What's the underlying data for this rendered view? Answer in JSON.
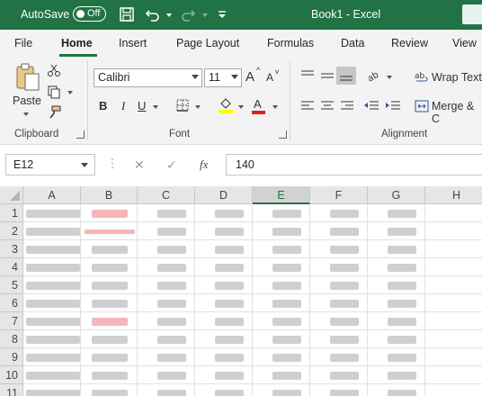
{
  "titlebar": {
    "autosave_label": "AutoSave",
    "toggle_state": "Off",
    "title": "Book1 - Excel"
  },
  "tabs": [
    {
      "label": "File",
      "active": false
    },
    {
      "label": "Home",
      "active": true
    },
    {
      "label": "Insert",
      "active": false
    },
    {
      "label": "Page Layout",
      "active": false
    },
    {
      "label": "Formulas",
      "active": false
    },
    {
      "label": "Data",
      "active": false
    },
    {
      "label": "Review",
      "active": false
    },
    {
      "label": "View",
      "active": false
    }
  ],
  "ribbon": {
    "clipboard": {
      "paste_label": "Paste",
      "group_label": "Clipboard"
    },
    "font": {
      "font_name": "Calibri",
      "font_size": "11",
      "bold": "B",
      "italic": "I",
      "underline": "U",
      "group_label": "Font",
      "grow": "A",
      "shrink": "A",
      "font_color_glyph": "A"
    },
    "alignment": {
      "wrap_text": "Wrap Text",
      "merge_center": "Merge & C",
      "group_label": "Alignment"
    }
  },
  "formula_bar": {
    "name_box": "E12",
    "cancel_glyph": "✕",
    "enter_glyph": "✓",
    "fx_glyph": "fx",
    "formula_value": "140"
  },
  "grid": {
    "columns": [
      "A",
      "B",
      "C",
      "D",
      "E",
      "F",
      "G",
      "H"
    ],
    "selected_column": "E",
    "rows": [
      "1",
      "2",
      "3",
      "4",
      "5",
      "6",
      "7",
      "8",
      "9",
      "10",
      "11"
    ]
  },
  "colors": {
    "brand": "#217346",
    "redacted_red": "#f2a9ad",
    "redacted_gray": "#c7c7c7"
  }
}
